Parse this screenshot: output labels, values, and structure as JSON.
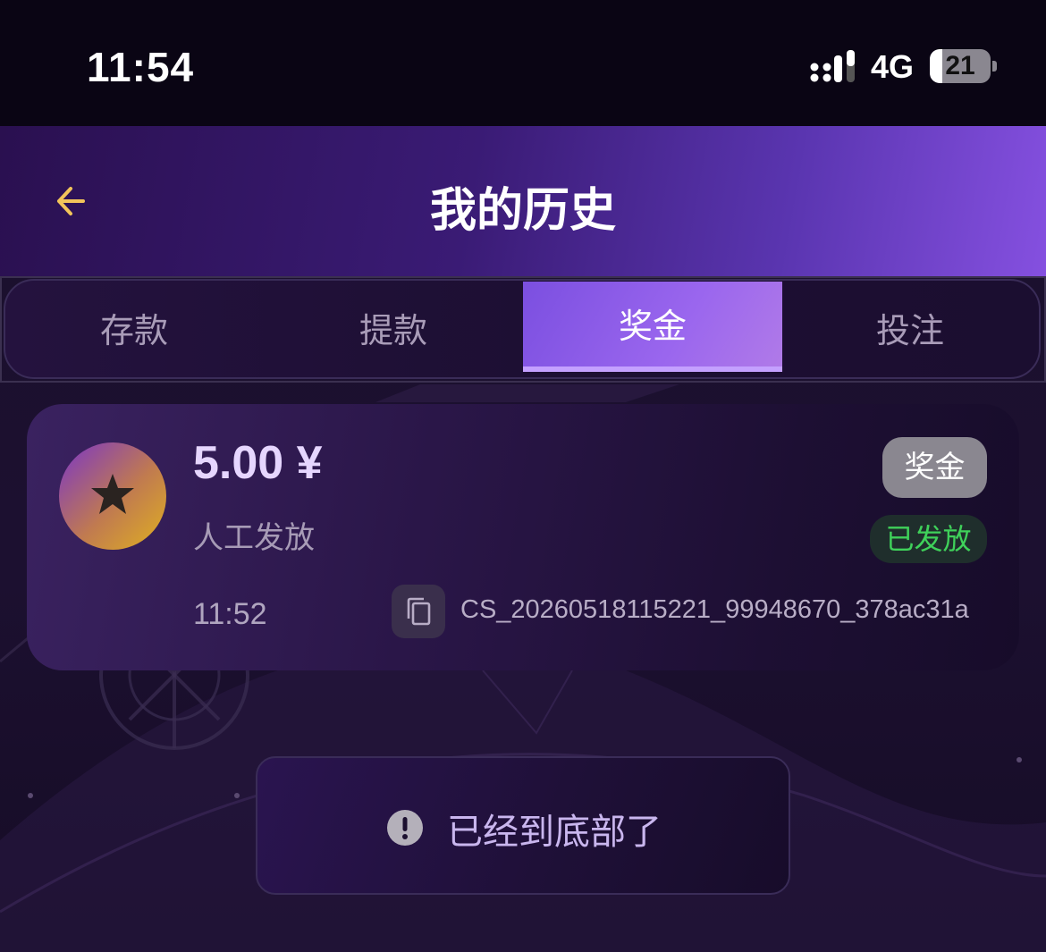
{
  "status_bar": {
    "time": "11:54",
    "network": "4G",
    "battery_level": "21",
    "battery_fraction": 0.21
  },
  "header": {
    "title": "我的历史",
    "back_icon": "arrow-left-icon",
    "accent_color": "#f2c45a"
  },
  "tabs": [
    {
      "label": "存款",
      "active": false
    },
    {
      "label": "提款",
      "active": false
    },
    {
      "label": "奖金",
      "active": true
    },
    {
      "label": "投注",
      "active": false
    }
  ],
  "records": [
    {
      "icon": "star-icon",
      "amount": "5.00 ¥",
      "source": "人工发放",
      "time": "11:52",
      "type_badge": "奖金",
      "status_badge": "已发放",
      "status_color": "#3fd15a",
      "copy_icon": "copy-icon",
      "order_id": "CS_20260518115221_99948670_378ac31a"
    }
  ],
  "end_notice": {
    "icon": "exclamation-circle-icon",
    "text": "已经到底部了"
  }
}
